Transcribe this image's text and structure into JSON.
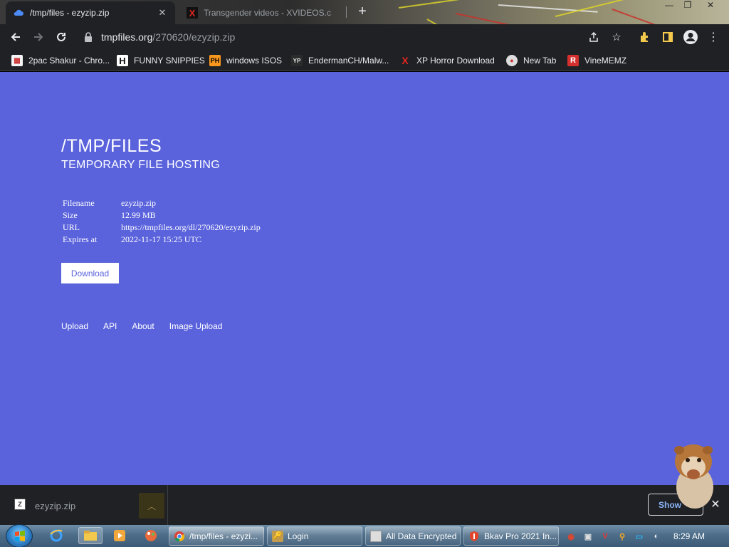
{
  "browser": {
    "tabs": [
      {
        "title": "/tmp/files - ezyzip.zip",
        "active": true
      },
      {
        "title": "Transgender videos - XVIDEOS.c",
        "active": false
      }
    ],
    "url": {
      "host": "tmpfiles.org",
      "path": "/270620/ezyzip.zip"
    },
    "bookmarks": [
      "2pac Shakur - Chro...",
      "FUNNY SNIPPIES",
      "windows ISOS",
      "EndermanCH/Malw...",
      "XP Horror Download",
      "New Tab",
      "VineMEMZ"
    ]
  },
  "page": {
    "title": "/TMP/FILES",
    "subtitle": "TEMPORARY FILE HOSTING",
    "file_info": [
      {
        "label": "Filename",
        "value": "ezyzip.zip"
      },
      {
        "label": "Size",
        "value": "12.99 MB"
      },
      {
        "label": "URL",
        "value": "https://tmpfiles.org/dl/270620/ezyzip.zip"
      },
      {
        "label": "Expires at",
        "value": "2022-11-17 15:25 UTC"
      }
    ],
    "download_label": "Download",
    "footer_links": [
      "Upload",
      "API",
      "About",
      "Image Upload"
    ],
    "background_color": "#5a63dc"
  },
  "download_shelf": {
    "file_name": "ezyzip.zip",
    "show_all_label": "Show"
  },
  "taskbar": {
    "tasks": [
      {
        "title": "/tmp/files - ezyzi...",
        "active": true
      },
      {
        "title": "Login",
        "active": false
      },
      {
        "title": "All Data Encrypted",
        "active": false
      },
      {
        "title": "Bkav Pro 2021 In...",
        "active": false
      }
    ],
    "clock": "8:29 AM"
  }
}
